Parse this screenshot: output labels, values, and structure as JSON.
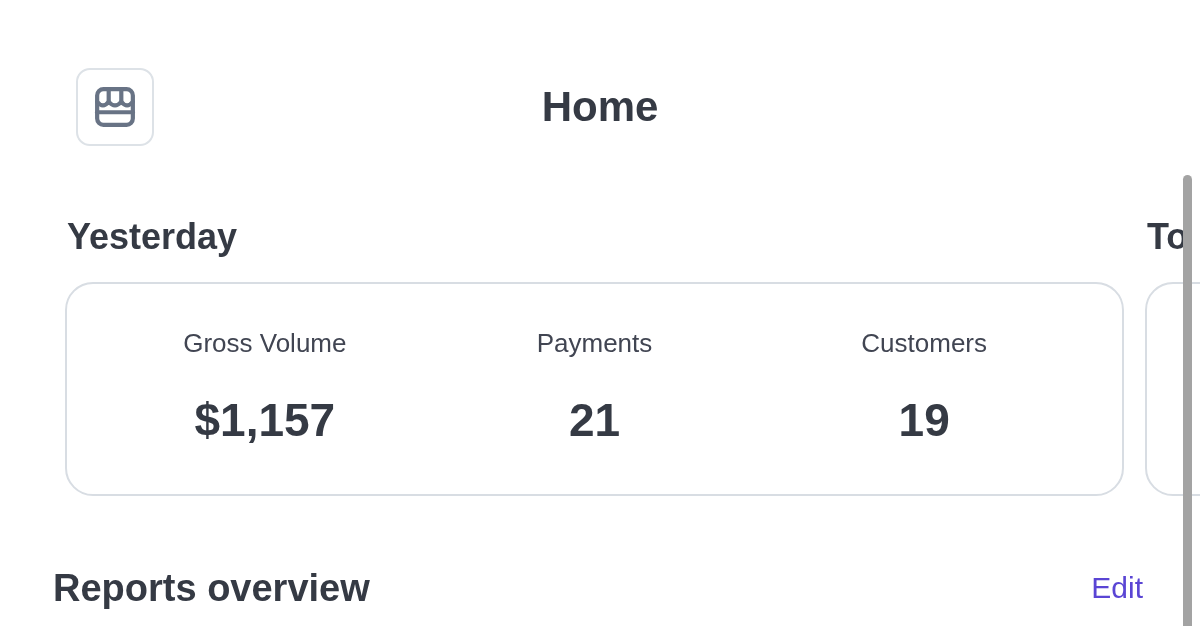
{
  "header": {
    "title": "Home"
  },
  "summary_sections": [
    {
      "title": "Yesterday",
      "metrics": [
        {
          "label": "Gross Volume",
          "value": "$1,157"
        },
        {
          "label": "Payments",
          "value": "21"
        },
        {
          "label": "Customers",
          "value": "19"
        }
      ]
    },
    {
      "title": "To"
    }
  ],
  "reports": {
    "title": "Reports overview",
    "edit_link": "Edit"
  }
}
